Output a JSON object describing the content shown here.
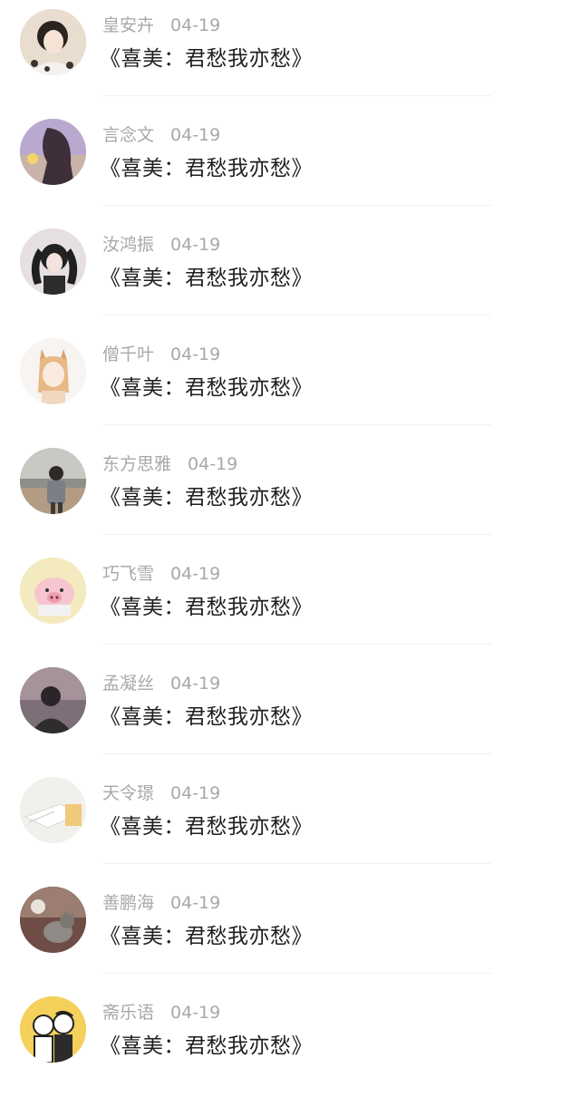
{
  "comments": [
    {
      "username": "皇安卉",
      "date": "04-19",
      "text": "《喜美：君愁我亦愁》",
      "avatar_icon": "girl-portrait-avatar",
      "avatar_color": "#d8c7b5"
    },
    {
      "username": "言念文",
      "date": "04-19",
      "text": "《喜美：君愁我亦愁》",
      "avatar_icon": "long-hair-girl-avatar",
      "avatar_color": "#b7a2c4"
    },
    {
      "username": "汝鸿振",
      "date": "04-19",
      "text": "《喜美：君愁我亦愁》",
      "avatar_icon": "twin-tail-girl-avatar",
      "avatar_color": "#cfc9cc"
    },
    {
      "username": "僧千叶",
      "date": "04-19",
      "text": "《喜美：君愁我亦愁》",
      "avatar_icon": "anime-cat-girl-avatar",
      "avatar_color": "#f2ede8"
    },
    {
      "username": "东方思雅",
      "date": "04-19",
      "text": "《喜美：君愁我亦愁》",
      "avatar_icon": "beach-man-avatar",
      "avatar_color": "#bfb7a6"
    },
    {
      "username": "巧飞雪",
      "date": "04-19",
      "text": "《喜美：君愁我亦愁》",
      "avatar_icon": "cartoon-pig-avatar",
      "avatar_color": "#f3e6b8"
    },
    {
      "username": "孟凝丝",
      "date": "04-19",
      "text": "《喜美：君愁我亦愁》",
      "avatar_icon": "silhouette-avatar",
      "avatar_color": "#6a5e66"
    },
    {
      "username": "天令璟",
      "date": "04-19",
      "text": "《喜美：君愁我亦愁》",
      "avatar_icon": "desk-notebook-avatar",
      "avatar_color": "#ecebe6"
    },
    {
      "username": "善鹏海",
      "date": "04-19",
      "text": "《喜美：君愁我亦愁》",
      "avatar_icon": "cat-photo-avatar",
      "avatar_color": "#8a6a5e"
    },
    {
      "username": "斋乐语",
      "date": "04-19",
      "text": "《喜美：君愁我亦愁》",
      "avatar_icon": "cartoon-couple-avatar",
      "avatar_color": "#f4cf55"
    }
  ]
}
